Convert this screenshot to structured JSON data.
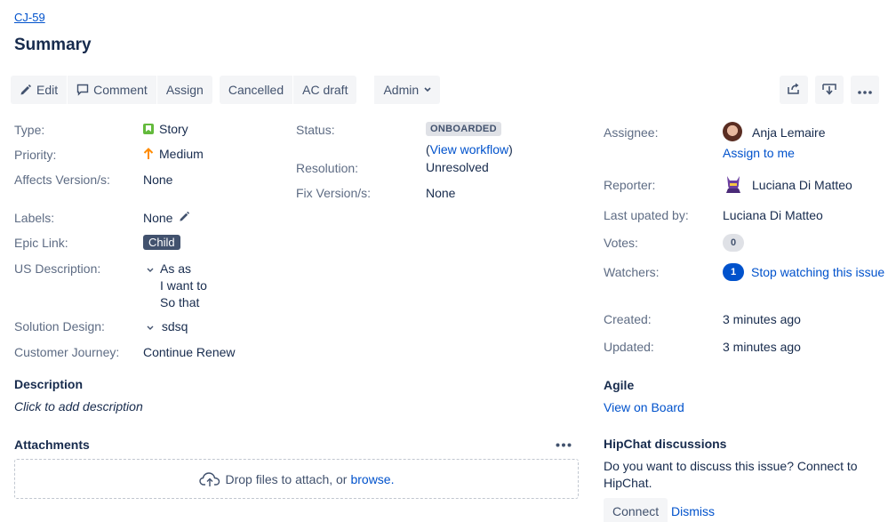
{
  "issue": {
    "key": "CJ-59",
    "summary": "Summary"
  },
  "toolbar": {
    "edit": "Edit",
    "comment": "Comment",
    "assign": "Assign",
    "cancelled": "Cancelled",
    "ac_draft": "AC draft",
    "admin": "Admin",
    "right_icons": [
      "share-icon",
      "export-icon",
      "more-icon"
    ]
  },
  "details": {
    "type_label": "Type:",
    "type_value": "Story",
    "priority_label": "Priority:",
    "priority_value": "Medium",
    "affects_label": "Affects Version/s:",
    "affects_value": "None",
    "labels_label": "Labels:",
    "labels_value": "None",
    "epic_label": "Epic Link:",
    "epic_value": "Child",
    "us_desc_label": "US Description:",
    "us_desc_lines": [
      "As as",
      "I want to",
      "So that"
    ],
    "solution_label": "Solution Design:",
    "solution_value": "sdsq",
    "journey_label": "Customer Journey:",
    "journey_value": "Continue Renew",
    "status_label": "Status:",
    "status_value": "ONBOARDED",
    "view_workflow_open": "(",
    "view_workflow": "View workflow",
    "view_workflow_close": ")",
    "resolution_label": "Resolution:",
    "resolution_value": "Unresolved",
    "fix_label": "Fix Version/s:",
    "fix_value": "None"
  },
  "people": {
    "assignee_label": "Assignee:",
    "assignee_name": "Anja Lemaire",
    "assign_to_me": "Assign to me",
    "reporter_label": "Reporter:",
    "reporter_name": "Luciana Di Matteo",
    "last_updated_label": "Last upated by:",
    "last_updated_name": "Luciana Di Matteo",
    "votes_label": "Votes:",
    "votes_count": "0",
    "watchers_label": "Watchers:",
    "watchers_count": "1",
    "stop_watching": "Stop watching this issue",
    "created_label": "Created:",
    "created_value": "3 minutes ago",
    "updated_label": "Updated:",
    "updated_value": "3 minutes ago"
  },
  "description": {
    "title": "Description",
    "placeholder": "Click to add description"
  },
  "attachments": {
    "title": "Attachments",
    "drop_text": "Drop files to attach, or ",
    "browse": "browse."
  },
  "agile": {
    "title": "Agile",
    "view_on_board": "View on Board"
  },
  "hipchat": {
    "title": "HipChat discussions",
    "text": "Do you want to discuss this issue? Connect to HipChat.",
    "connect": "Connect",
    "dismiss": "Dismiss"
  },
  "colors": {
    "link": "#0052cc",
    "label_gray": "#5e6c84",
    "text": "#172b4d",
    "button_bg": "#f4f5f7",
    "story_green": "#63ba3c",
    "priority_orange": "#ff8b00",
    "epic_bg": "#42526e"
  }
}
